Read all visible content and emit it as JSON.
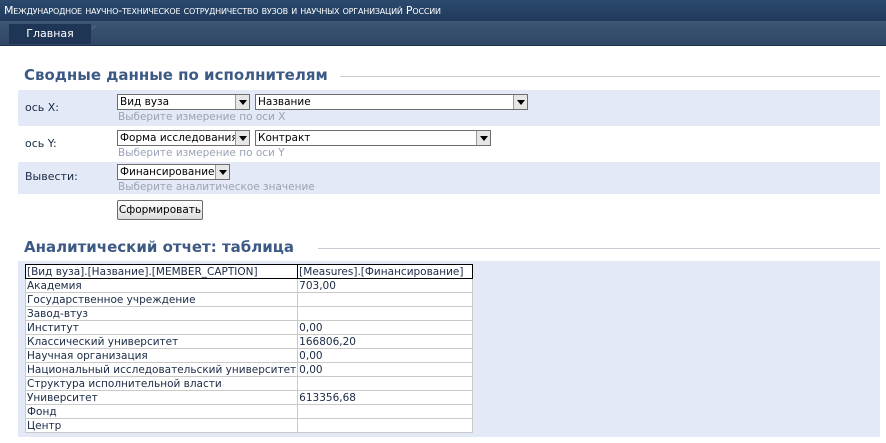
{
  "header": {
    "site_title": "Международное научно-техническое сотрудничество вузов и научных организаций России"
  },
  "nav": {
    "items": [
      {
        "label": "Главная"
      }
    ]
  },
  "summary_section": {
    "title": "Сводные данные по исполнителям",
    "x_axis": {
      "label": "ось X:",
      "dimension": "Вид вуза",
      "attribute": "Название",
      "hint": "Выберите измерение по оси X"
    },
    "y_axis": {
      "label": "ось Y:",
      "dimension": "Форма исследования",
      "attribute": "Контракт",
      "hint": "Выберите измерение по оси Y"
    },
    "output": {
      "label": "Вывести:",
      "value": "Финансирование",
      "hint": "Выберите аналитическое значение"
    },
    "submit_label": "Сформировать"
  },
  "report_section": {
    "title": "Аналитический отчет: таблица",
    "columns": [
      "[Вид вуза].[Название].[MEMBER_CAPTION]",
      "[Measures].[Финансирование]"
    ],
    "rows": [
      [
        "Академия",
        "703,00"
      ],
      [
        "Государственное учреждение",
        ""
      ],
      [
        "Завод-втуз",
        ""
      ],
      [
        "Институт",
        "0,00"
      ],
      [
        "Классический университет",
        "166806,20"
      ],
      [
        "Научная организация",
        "0,00"
      ],
      [
        "Национальный исследовательский университет",
        "0,00"
      ],
      [
        "Структура исполнительной власти",
        ""
      ],
      [
        "Университет",
        "613356,68"
      ],
      [
        "Фонд",
        ""
      ],
      [
        "Центр",
        ""
      ]
    ]
  }
}
